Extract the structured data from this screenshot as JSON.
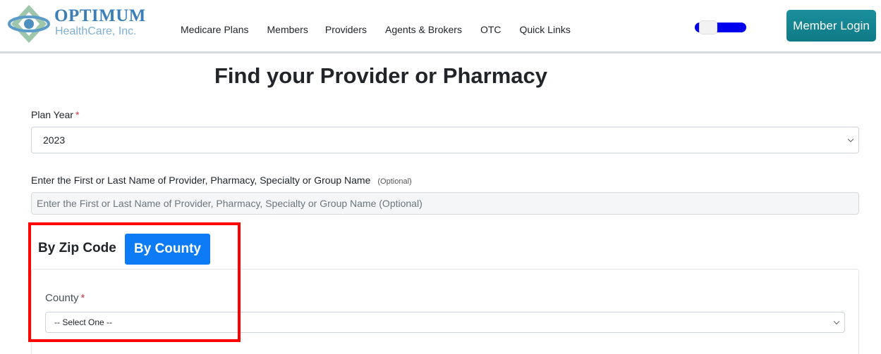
{
  "header": {
    "logo": {
      "word": "OPTIMUM",
      "sub": "HealthCare, Inc."
    },
    "nav": [
      "Medicare Plans",
      "Members",
      "Providers",
      "Agents & Brokers",
      "OTC",
      "Quick Links"
    ],
    "login_label": "Member Login",
    "toggle_color": "#0000ee",
    "login_color": "#138496"
  },
  "main": {
    "title": "Find your Provider or Pharmacy",
    "plan_year": {
      "label": "Plan Year",
      "required": "*",
      "value": "2023"
    },
    "search": {
      "label": "Enter the First or Last Name of Provider, Pharmacy, Specialty or Group Name",
      "optional": "(Optional)",
      "placeholder": "Enter the First or Last Name of Provider, Pharmacy, Specialty or Group Name (Optional)"
    },
    "tabs": [
      {
        "label": "By Zip Code",
        "active": false
      },
      {
        "label": "By County",
        "active": true
      }
    ],
    "county": {
      "label": "County",
      "required": "*",
      "value": "-- Select One --"
    }
  },
  "colors": {
    "accent": "#0d7bf5",
    "required": "#dc3545",
    "highlight": "#ff0000"
  }
}
